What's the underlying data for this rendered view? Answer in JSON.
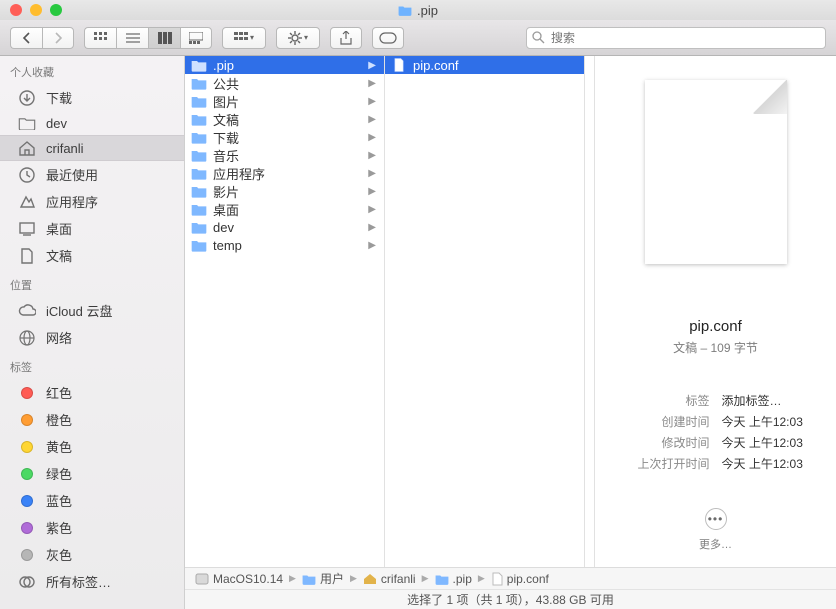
{
  "window": {
    "title": ".pip"
  },
  "search": {
    "placeholder": "搜索"
  },
  "sidebar": {
    "sections": [
      {
        "title": "个人收藏",
        "items": [
          {
            "icon": "download",
            "label": "下载"
          },
          {
            "icon": "folder",
            "label": "dev"
          },
          {
            "icon": "home",
            "label": "crifanli",
            "selected": true
          },
          {
            "icon": "clock",
            "label": "最近使用"
          },
          {
            "icon": "apps",
            "label": "应用程序"
          },
          {
            "icon": "desktop",
            "label": "桌面"
          },
          {
            "icon": "document",
            "label": "文稿"
          }
        ]
      },
      {
        "title": "位置",
        "items": [
          {
            "icon": "cloud",
            "label": "iCloud 云盘"
          },
          {
            "icon": "network",
            "label": "网络"
          }
        ]
      },
      {
        "title": "标签",
        "items": [
          {
            "icon": "tag",
            "color": "#ff5b54",
            "label": "红色"
          },
          {
            "icon": "tag",
            "color": "#ff9d33",
            "label": "橙色"
          },
          {
            "icon": "tag",
            "color": "#ffd633",
            "label": "黄色"
          },
          {
            "icon": "tag",
            "color": "#4cd964",
            "label": "绿色"
          },
          {
            "icon": "tag",
            "color": "#3a82f7",
            "label": "蓝色"
          },
          {
            "icon": "tag",
            "color": "#b06cd8",
            "label": "紫色"
          },
          {
            "icon": "tag",
            "color": "#b6b6b6",
            "label": "灰色"
          },
          {
            "icon": "alltags",
            "label": "所有标签…"
          }
        ]
      }
    ]
  },
  "col1": [
    {
      "label": ".pip",
      "selected": true,
      "children": true
    },
    {
      "label": "公共",
      "children": true
    },
    {
      "label": "图片",
      "children": true
    },
    {
      "label": "文稿",
      "children": true
    },
    {
      "label": "下载",
      "children": true
    },
    {
      "label": "音乐",
      "children": true
    },
    {
      "label": "应用程序",
      "children": true
    },
    {
      "label": "影片",
      "children": true
    },
    {
      "label": "桌面",
      "children": true
    },
    {
      "label": "dev",
      "children": true
    },
    {
      "label": "temp",
      "children": true
    }
  ],
  "col2": [
    {
      "label": "pip.conf",
      "selected": true,
      "children": false
    }
  ],
  "preview": {
    "name": "pip.conf",
    "subtitle": "文稿 – 109 字节",
    "tags_label": "标签",
    "tags_add": "添加标签…",
    "created_label": "创建时间",
    "created_value": "今天 上午12:03",
    "modified_label": "修改时间",
    "modified_value": "今天 上午12:03",
    "opened_label": "上次打开时间",
    "opened_value": "今天 上午12:03",
    "more": "更多…"
  },
  "pathbar": [
    {
      "icon": "disk",
      "label": "MacOS10.14"
    },
    {
      "icon": "folder",
      "label": "用户"
    },
    {
      "icon": "home",
      "label": "crifanli"
    },
    {
      "icon": "folder",
      "label": ".pip"
    },
    {
      "icon": "doc",
      "label": "pip.conf"
    }
  ],
  "status": "选择了 1 项（共 1 项），43.88 GB 可用"
}
